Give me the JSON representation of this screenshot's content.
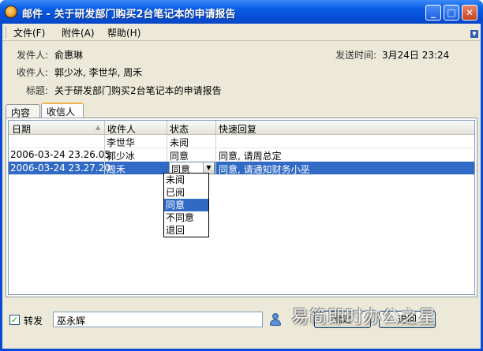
{
  "window": {
    "title": "邮件 - 关于研发部门购买2台笔记本的申请报告",
    "minimize_icon": "minimize-icon",
    "maximize_icon": "maximize-icon",
    "close_icon": "close-icon"
  },
  "menu": {
    "items": [
      "文件(F)",
      "附件(A)",
      "帮助(H)"
    ]
  },
  "header": {
    "sender_label": "发件人:",
    "sender": "俞惠琳",
    "send_time_label": "发送时间:",
    "send_time": "3月24日 23:24",
    "recipients_label": "收件人:",
    "recipients": "郭少冰, 李世华, 周禾",
    "subject_label": "标题:",
    "subject": "关于研发部门购买2台笔记本的申请报告"
  },
  "tabs": [
    "内容",
    "收信人"
  ],
  "grid": {
    "columns": [
      "日期",
      "收件人",
      "状态",
      "快速回复"
    ],
    "rows": [
      {
        "date": "",
        "recipient": "李世华",
        "status": "未阅",
        "reply": ""
      },
      {
        "date": "2006-03-24 23.26.05",
        "recipient": "郭少冰",
        "status": "同意",
        "reply": "同意, 请周总定"
      },
      {
        "date": "2006-03-24 23.27.20",
        "recipient": "周禾",
        "status": "同意",
        "reply": "同意, 请通知财务小巫"
      }
    ],
    "selected_row": 2
  },
  "status_dropdown": {
    "options": [
      "未阅",
      "已阅",
      "同意",
      "不同意",
      "退回"
    ],
    "selected": "同意"
  },
  "footer": {
    "forward_label": "转发",
    "forward_checked": true,
    "forward_value": "巫永辉",
    "ok_label": "确定",
    "back_label": "退回"
  },
  "watermark": "易简即时办公之星",
  "colors": {
    "titlebar": "#0550d8",
    "selection": "#316ac5",
    "face": "#ece9d8"
  }
}
